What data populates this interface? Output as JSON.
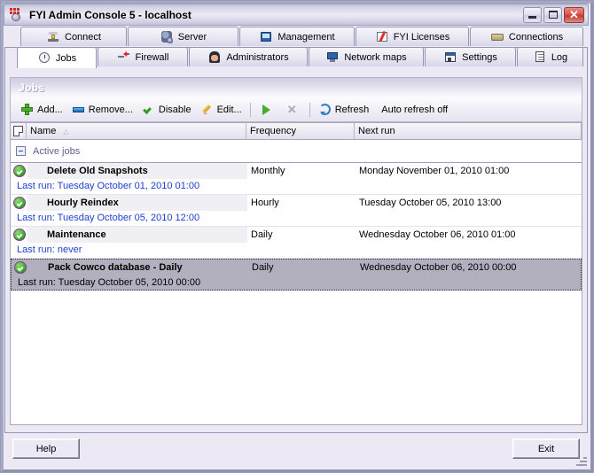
{
  "window": {
    "title": "FYI Admin Console 5 - localhost",
    "app_icon": "app-icon",
    "minimize_label": "",
    "maximize_label": "",
    "close_label": "✕"
  },
  "tabs": {
    "row1": [
      {
        "label": "Connect",
        "icon": "connect-icon",
        "selected": false
      },
      {
        "label": "Server",
        "icon": "server-icon",
        "selected": false
      },
      {
        "label": "Management",
        "icon": "management-icon",
        "selected": false
      },
      {
        "label": "FYI Licenses",
        "icon": "license-icon",
        "selected": false
      },
      {
        "label": "Connections",
        "icon": "connections-icon",
        "selected": false
      }
    ],
    "row2": [
      {
        "label": "Jobs",
        "icon": "clock-icon",
        "selected": true
      },
      {
        "label": "Firewall",
        "icon": "firewall-icon",
        "selected": false
      },
      {
        "label": "Administrators",
        "icon": "administrator-icon",
        "selected": false
      },
      {
        "label": "Network maps",
        "icon": "network-map-icon",
        "selected": false
      },
      {
        "label": "Settings",
        "icon": "settings-icon",
        "selected": false
      },
      {
        "label": "Log",
        "icon": "log-icon",
        "selected": false
      }
    ]
  },
  "panel": {
    "band_title": "Jobs"
  },
  "toolbar": {
    "add_label": "Add...",
    "remove_label": "Remove...",
    "disable_label": "Disable",
    "edit_label": "Edit...",
    "run_label": "",
    "stop_label": "",
    "refresh_label": "Refresh",
    "auto_refresh_label": "Auto refresh off"
  },
  "list": {
    "columns": {
      "icon": "",
      "name": "Name",
      "frequency": "Frequency",
      "next_run": "Next run"
    },
    "sort_indicator": "△",
    "group_label": "Active jobs",
    "rows": [
      {
        "status": "ok",
        "name": "Delete Old Snapshots",
        "frequency": "Monthly",
        "next_run": "Monday November 01, 2010 01:00",
        "last_run": "Last run: Tuesday October 01, 2010 01:00",
        "selected": false
      },
      {
        "status": "ok",
        "name": "Hourly Reindex",
        "frequency": "Hourly",
        "next_run": "Tuesday October 05, 2010 13:00",
        "last_run": "Last run: Tuesday October 05, 2010 12:00",
        "selected": false
      },
      {
        "status": "ok",
        "name": "Maintenance",
        "frequency": "Daily",
        "next_run": "Wednesday October 06, 2010 01:00",
        "last_run": "Last run: never",
        "selected": false
      },
      {
        "status": "ok",
        "name": "Pack Cowco database - Daily",
        "frequency": "Daily",
        "next_run": "Wednesday October 06, 2010 00:00",
        "last_run": "Last run: Tuesday October 05, 2010 00:00",
        "selected": true
      }
    ]
  },
  "footer": {
    "help_label": "Help",
    "exit_label": "Exit"
  },
  "colors": {
    "selection": "#b2b0be",
    "link_text": "#1c3fd0",
    "group_text": "#5c6391",
    "close_button": "#c23c31",
    "status_ok": "#46b034"
  }
}
